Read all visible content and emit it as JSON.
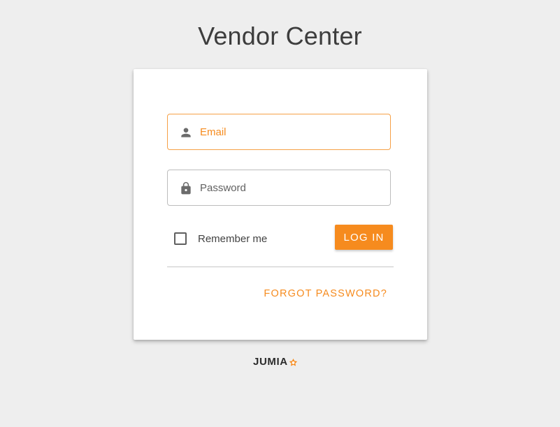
{
  "page": {
    "title": "Vendor Center"
  },
  "login_form": {
    "email": {
      "placeholder": "Email",
      "value": "",
      "icon": "person-icon"
    },
    "password": {
      "placeholder": "Password",
      "value": "",
      "icon": "lock-icon"
    },
    "remember_me": {
      "label": "Remember me",
      "checked": false
    },
    "login_button_label": "LOG IN",
    "forgot_password_label": "FORGOT PASSWORD?"
  },
  "footer": {
    "logo_text": "JUMIA",
    "logo_icon": "star-icon"
  },
  "colors": {
    "accent": "#f68b1e",
    "focus_border": "#f6a046",
    "background": "#eeeeee",
    "card": "#ffffff",
    "title_text": "#3d3d3d"
  }
}
